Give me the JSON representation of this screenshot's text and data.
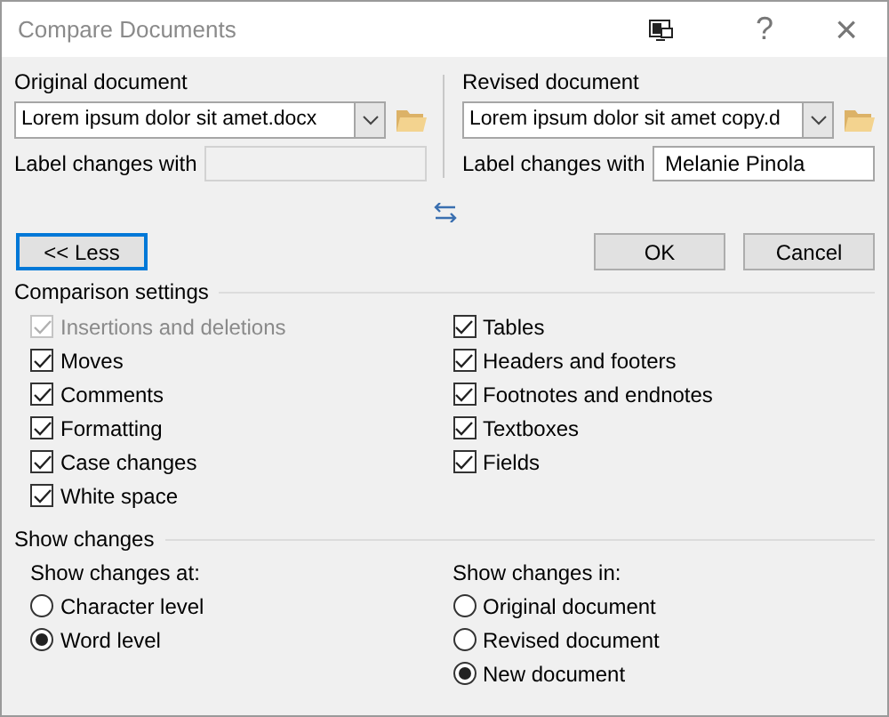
{
  "window": {
    "title": "Compare Documents",
    "help": "?",
    "close": "×"
  },
  "original": {
    "heading": "Original document",
    "file": "Lorem ipsum dolor sit amet.docx",
    "label_caption": "Label changes with"
  },
  "revised": {
    "heading": "Revised document",
    "file": "Lorem ipsum dolor sit amet copy.d",
    "label_caption": "Label changes with",
    "label_value": "Melanie Pinola"
  },
  "buttons": [
    {
      "label": "<< Less",
      "kind": "toggle",
      "focused": true
    },
    {
      "label": "OK",
      "kind": "action",
      "focused": false
    },
    {
      "label": "Cancel",
      "kind": "action",
      "focused": false
    }
  ],
  "comparison_settings": {
    "title": "Comparison settings",
    "columns": [
      [
        {
          "label": "Insertions and deletions",
          "checked": true,
          "disabled": true
        },
        {
          "label": "Moves",
          "checked": true,
          "disabled": false
        },
        {
          "label": "Comments",
          "checked": true,
          "disabled": false
        },
        {
          "label": "Formatting",
          "checked": true,
          "disabled": false
        },
        {
          "label": "Case changes",
          "checked": true,
          "disabled": false
        },
        {
          "label": "White space",
          "checked": true,
          "disabled": false
        }
      ],
      [
        {
          "label": "Tables",
          "checked": true,
          "disabled": false
        },
        {
          "label": "Headers and footers",
          "checked": true,
          "disabled": false
        },
        {
          "label": "Footnotes and endnotes",
          "checked": true,
          "disabled": false
        },
        {
          "label": "Textboxes",
          "checked": true,
          "disabled": false
        },
        {
          "label": "Fields",
          "checked": true,
          "disabled": false
        }
      ]
    ]
  },
  "show_changes": {
    "title": "Show changes",
    "groups": [
      {
        "heading": "Show changes at:",
        "options": [
          {
            "label": "Character level",
            "selected": false
          },
          {
            "label": "Word level",
            "selected": true
          }
        ]
      },
      {
        "heading": "Show changes in:",
        "options": [
          {
            "label": "Original document",
            "selected": false
          },
          {
            "label": "Revised document",
            "selected": false
          },
          {
            "label": "New document",
            "selected": true
          }
        ]
      }
    ]
  }
}
